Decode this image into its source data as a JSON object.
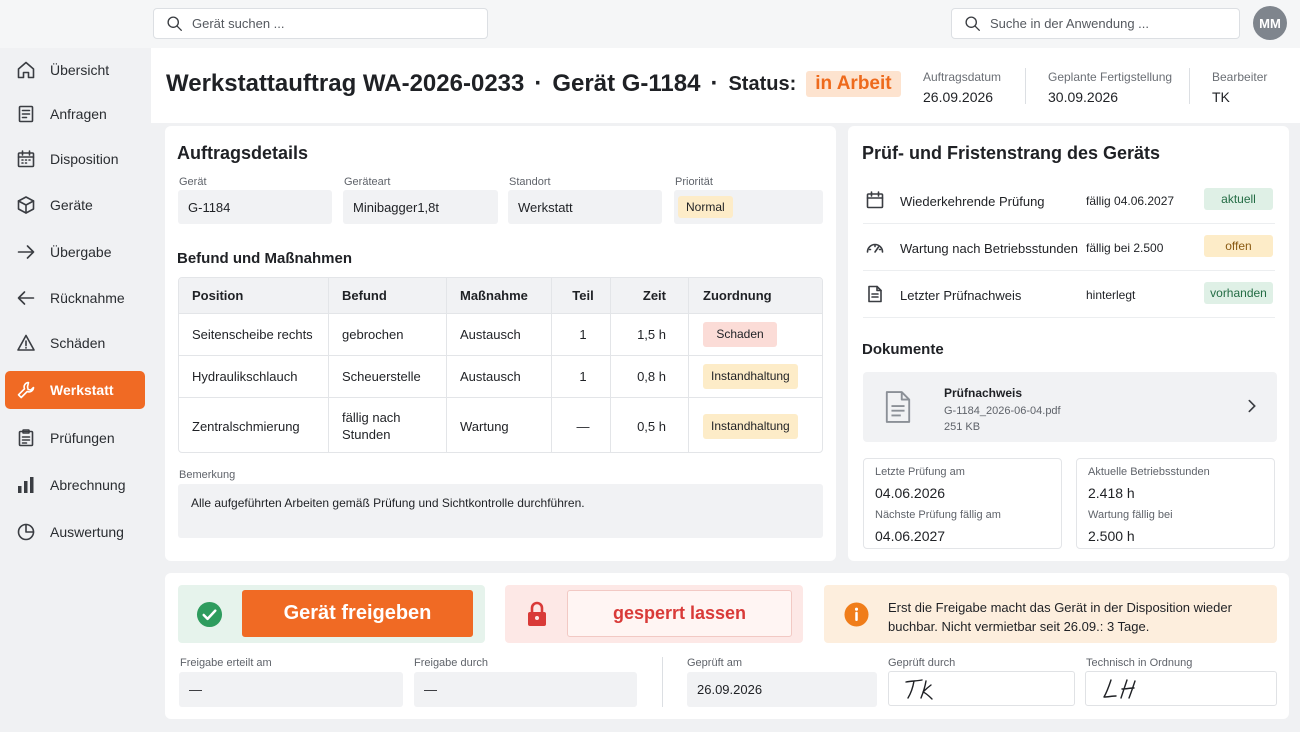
{
  "topbar": {
    "device_search_placeholder": "Gerät suchen ...",
    "app_search_placeholder": "Suche in der Anwendung ...",
    "user_initials": "MM"
  },
  "sidebar": {
    "items": [
      {
        "label": "Übersicht",
        "icon": "home-icon"
      },
      {
        "label": "Anfragen",
        "icon": "document-icon"
      },
      {
        "label": "Disposition",
        "icon": "calendar-icon"
      },
      {
        "label": "Geräte",
        "icon": "box-icon"
      },
      {
        "label": "Übergabe",
        "icon": "arrow-right-icon"
      },
      {
        "label": "Rücknahme",
        "icon": "arrow-left-icon"
      },
      {
        "label": "Schäden",
        "icon": "warning-icon"
      },
      {
        "label": "Werkstatt",
        "icon": "wrench-icon",
        "active": true
      },
      {
        "label": "Prüfungen",
        "icon": "clipboard-icon"
      },
      {
        "label": "Abrechnung",
        "icon": "bar-chart-icon"
      },
      {
        "label": "Auswertung",
        "icon": "pie-chart-icon"
      }
    ]
  },
  "header": {
    "order_title": "Werkstattauftrag WA-2026-0233",
    "separator": "·",
    "device_title": "Gerät G-1184",
    "status_label": "Status:",
    "status_value": "in Arbeit",
    "meta": [
      {
        "label": "Auftragsdatum",
        "value": "26.09.2026"
      },
      {
        "label": "Geplante Fertigstellung",
        "value": "30.09.2026"
      },
      {
        "label": "Bearbeiter",
        "value": "TK"
      }
    ]
  },
  "details": {
    "title": "Auftragsdetails",
    "fields": [
      {
        "label": "Gerät",
        "value": "G-1184"
      },
      {
        "label": "Geräteart",
        "value": "Minibagger1,8t"
      },
      {
        "label": "Standort",
        "value": "Werkstatt"
      },
      {
        "label": "Priorität",
        "value": "Normal"
      }
    ],
    "findings_title": "Befund und Maßnahmen",
    "table": {
      "headers": [
        "Position",
        "Befund",
        "Maßnahme",
        "Teil",
        "Zeit",
        "Zuordnung"
      ],
      "rows": [
        {
          "position": "Seitenscheibe rechts",
          "befund": "gebrochen",
          "massnahme": "Austausch",
          "teil": "1",
          "zeit": "1,5 h",
          "zuordnung": "Schaden"
        },
        {
          "position": "Hydraulikschlauch",
          "befund": "Scheuerstelle",
          "massnahme": "Austausch",
          "teil": "1",
          "zeit": "0,8 h",
          "zuordnung": "Instandhaltung"
        },
        {
          "position": "Zentralschmierung",
          "befund": "fällig nach Stunden",
          "massnahme": "Wartung",
          "teil": "—",
          "zeit": "0,5 h",
          "zuordnung": "Instandhaltung"
        }
      ]
    },
    "remark_label": "Bemerkung",
    "remark_value": "Alle aufgeführten Arbeiten gemäß Prüfung und Sichtkontrolle durchführen."
  },
  "inspection": {
    "title": "Prüf- und Fristenstrang des Geräts",
    "rows": [
      {
        "name": "Wiederkehrende Prüfung",
        "due": "fällig 04.06.2027",
        "badge": "aktuell",
        "icon": "calendar-icon"
      },
      {
        "name": "Wartung nach Betriebsstunden",
        "due": "fällig bei 2.500",
        "badge": "offen",
        "icon": "gauge-icon"
      },
      {
        "name": "Letzter Prüfnachweis",
        "due": "hinterlegt",
        "badge": "vorhanden",
        "icon": "file-icon"
      }
    ],
    "documents_title": "Dokumente",
    "document": {
      "title": "Prüfnachweis",
      "filename": "G-1184_2026-06-04.pdf",
      "size": "251 KB"
    },
    "info_left": {
      "label1": "Letzte Prüfung am",
      "value1": "04.06.2026",
      "label2": "Nächste Prüfung fällig am",
      "value2": "04.06.2027"
    },
    "info_right": {
      "label1": "Aktuelle Betriebsstunden",
      "value1": "2.418 h",
      "label2": "Wartung fällig bei",
      "value2": "2.500 h"
    }
  },
  "actions": {
    "release_button": "Gerät freigeben",
    "lock_button": "gesperrt lassen",
    "notice_line1": "Erst die Freigabe macht das Gerät in der Disposition wieder",
    "notice_line2": "buchbar. Nicht vermietbar seit 26.09.: 3 Tage.",
    "fields": [
      {
        "label": "Freigabe erteilt am",
        "value": "—"
      },
      {
        "label": "Freigabe durch",
        "value": "—"
      },
      {
        "label": "Geprüft am",
        "value": "26.09.2026"
      },
      {
        "label": "Geprüft durch",
        "signature": "TK"
      },
      {
        "label": "Technisch in Ordnung",
        "signature": "LH"
      }
    ]
  },
  "colors": {
    "accent": "#f06a24",
    "success": "#2e9c5e",
    "danger": "#d93a38",
    "warning_badge": "#fdecc8",
    "info_icon": "#f07d1a"
  }
}
